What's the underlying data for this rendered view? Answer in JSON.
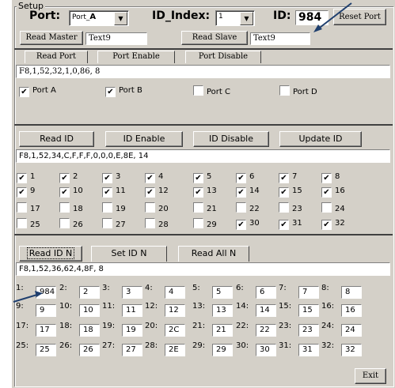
{
  "setup": {
    "title": "Setup",
    "port_label": "Port:",
    "port_value": "Port_",
    "port_value_bold": "A",
    "id_index_label": "ID_Index:",
    "id_index_value": "1",
    "id_label": "ID:",
    "id_value": "984",
    "reset_port": "Reset Port",
    "read_master": "Read Master",
    "master_text": "Text9",
    "read_slave": "Read Slave",
    "slave_text": "Text9"
  },
  "port_section": {
    "read_port": "Read Port",
    "port_enable": "Port Enable",
    "port_disable": "Port Disable",
    "data": "F8,1,52,32,1,0,86, 8",
    "ports": [
      {
        "label": "Port A",
        "checked": true
      },
      {
        "label": "Port B",
        "checked": true
      },
      {
        "label": "Port C",
        "checked": false
      },
      {
        "label": "Port D",
        "checked": false
      }
    ]
  },
  "id_section": {
    "read_id": "Read ID",
    "id_enable": "ID Enable",
    "id_disable": "ID Disable",
    "update_id": "Update ID",
    "data": "F8,1,52,34,C,F,F,F,0,0,0,E,8E, 14",
    "checks": [
      {
        "label": "1",
        "checked": true
      },
      {
        "label": "2",
        "checked": true
      },
      {
        "label": "3",
        "checked": true
      },
      {
        "label": "4",
        "checked": true
      },
      {
        "label": "5",
        "checked": true
      },
      {
        "label": "6",
        "checked": true
      },
      {
        "label": "7",
        "checked": true
      },
      {
        "label": "8",
        "checked": true
      },
      {
        "label": "9",
        "checked": true
      },
      {
        "label": "10",
        "checked": true
      },
      {
        "label": "11",
        "checked": true
      },
      {
        "label": "12",
        "checked": true
      },
      {
        "label": "13",
        "checked": true
      },
      {
        "label": "14",
        "checked": true
      },
      {
        "label": "15",
        "checked": true
      },
      {
        "label": "16",
        "checked": true
      },
      {
        "label": "17",
        "checked": false
      },
      {
        "label": "18",
        "checked": false
      },
      {
        "label": "19",
        "checked": false
      },
      {
        "label": "20",
        "checked": false
      },
      {
        "label": "21",
        "checked": false
      },
      {
        "label": "22",
        "checked": false
      },
      {
        "label": "23",
        "checked": false
      },
      {
        "label": "24",
        "checked": false
      },
      {
        "label": "25",
        "checked": false
      },
      {
        "label": "26",
        "checked": false
      },
      {
        "label": "27",
        "checked": false
      },
      {
        "label": "28",
        "checked": false
      },
      {
        "label": "29",
        "checked": false
      },
      {
        "label": "30",
        "checked": true
      },
      {
        "label": "31",
        "checked": true
      },
      {
        "label": "32",
        "checked": true
      }
    ]
  },
  "idn_section": {
    "read_id_n": "Read ID N",
    "set_id_n": "Set ID N",
    "read_all_n": "Read All N",
    "data": "F8,1,52,36,62,4,8F, 8",
    "entries": [
      {
        "label": "1:",
        "value": "984"
      },
      {
        "label": "2:",
        "value": "2"
      },
      {
        "label": "3:",
        "value": "3"
      },
      {
        "label": "4:",
        "value": "4"
      },
      {
        "label": "5:",
        "value": "5"
      },
      {
        "label": "6:",
        "value": "6"
      },
      {
        "label": "7:",
        "value": "7"
      },
      {
        "label": "8:",
        "value": "8"
      },
      {
        "label": "9:",
        "value": "9"
      },
      {
        "label": "10:",
        "value": "10"
      },
      {
        "label": "11:",
        "value": "11"
      },
      {
        "label": "12:",
        "value": "12"
      },
      {
        "label": "13:",
        "value": "13"
      },
      {
        "label": "14:",
        "value": "14"
      },
      {
        "label": "15:",
        "value": "15"
      },
      {
        "label": "16:",
        "value": "16"
      },
      {
        "label": "17:",
        "value": "17"
      },
      {
        "label": "18:",
        "value": "18"
      },
      {
        "label": "19:",
        "value": "19"
      },
      {
        "label": "20:",
        "value": "2C"
      },
      {
        "label": "21:",
        "value": "21"
      },
      {
        "label": "22:",
        "value": "22"
      },
      {
        "label": "23:",
        "value": "23"
      },
      {
        "label": "24:",
        "value": "24"
      },
      {
        "label": "25:",
        "value": "25"
      },
      {
        "label": "26:",
        "value": "26"
      },
      {
        "label": "27:",
        "value": "27"
      },
      {
        "label": "28:",
        "value": "2E"
      },
      {
        "label": "29:",
        "value": "29"
      },
      {
        "label": "30:",
        "value": "30"
      },
      {
        "label": "31:",
        "value": "31"
      },
      {
        "label": "32:",
        "value": "32"
      }
    ],
    "exit": "Exit"
  },
  "annotations": {
    "arrow_color": "#1f3f6e",
    "check_mark": "✔"
  }
}
